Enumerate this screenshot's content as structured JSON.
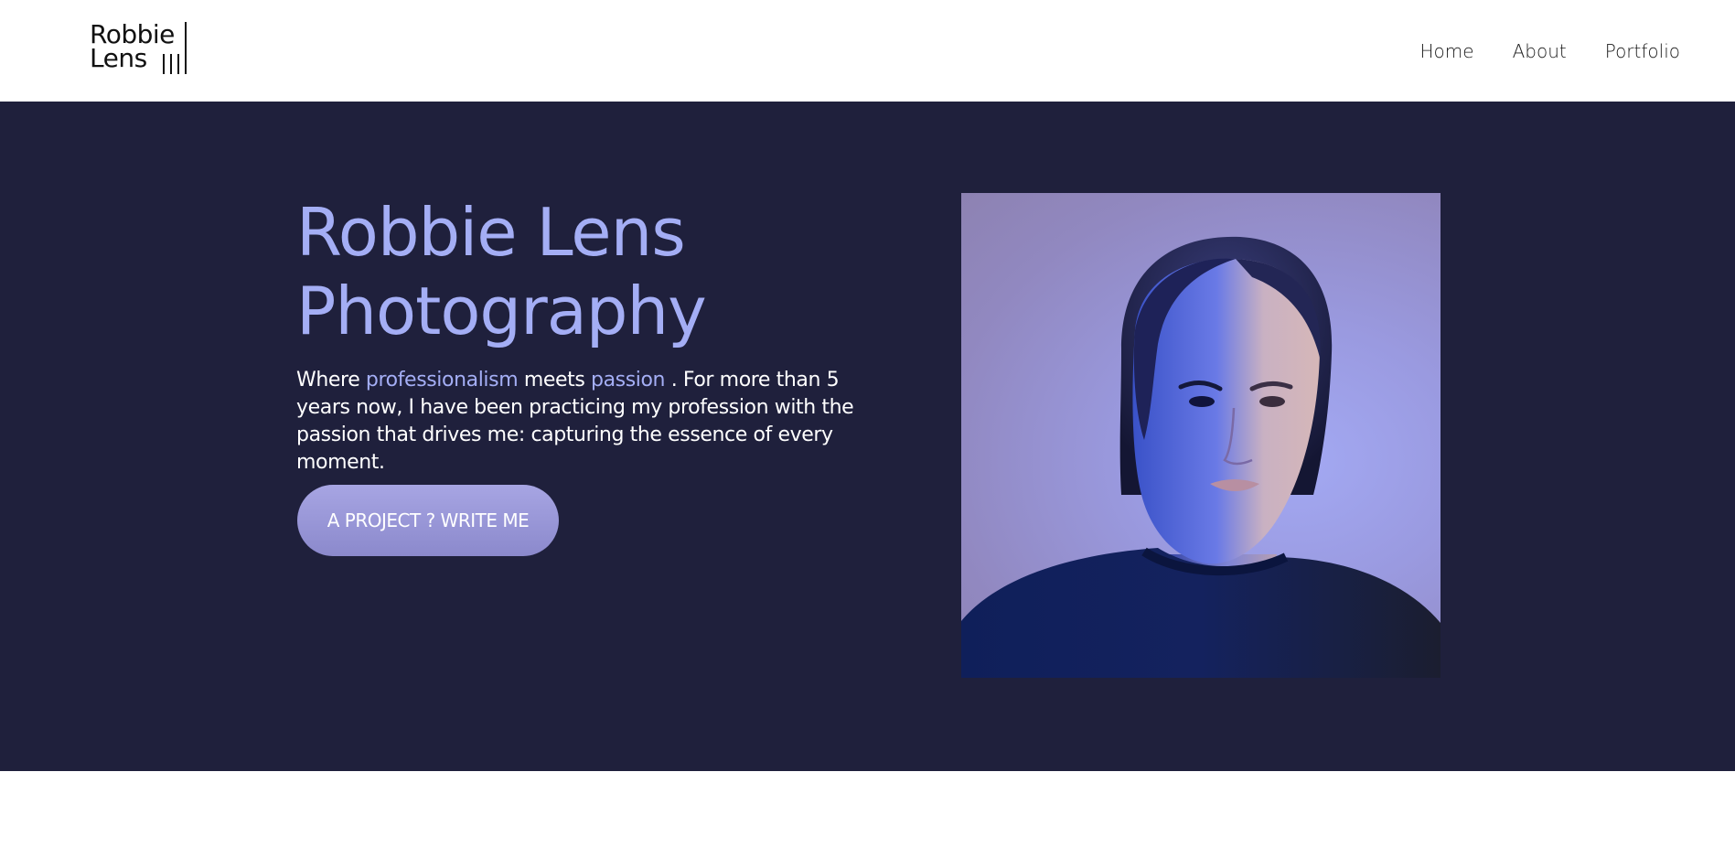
{
  "header": {
    "logo": {
      "line1": "Robbie",
      "line2": "Lens"
    },
    "nav": [
      {
        "label": "Home"
      },
      {
        "label": "About"
      },
      {
        "label": "Portfolio"
      }
    ]
  },
  "hero": {
    "title_line1": "Robbie Lens",
    "title_line2": "Photography",
    "description": {
      "part1": "Where ",
      "highlight1": "professionalism",
      "part2": " meets ",
      "highlight2": "passion",
      "part3": " . For more than 5 years now, I have been practicing my profession with the passion that drives me: capturing the essence of every moment."
    },
    "cta_label": "A PROJECT ? WRITE ME",
    "portrait_alt": "Portrait photo"
  },
  "colors": {
    "accent": "#a4aef5",
    "hero_background": "#1f203c",
    "button": "#9a98d8"
  }
}
